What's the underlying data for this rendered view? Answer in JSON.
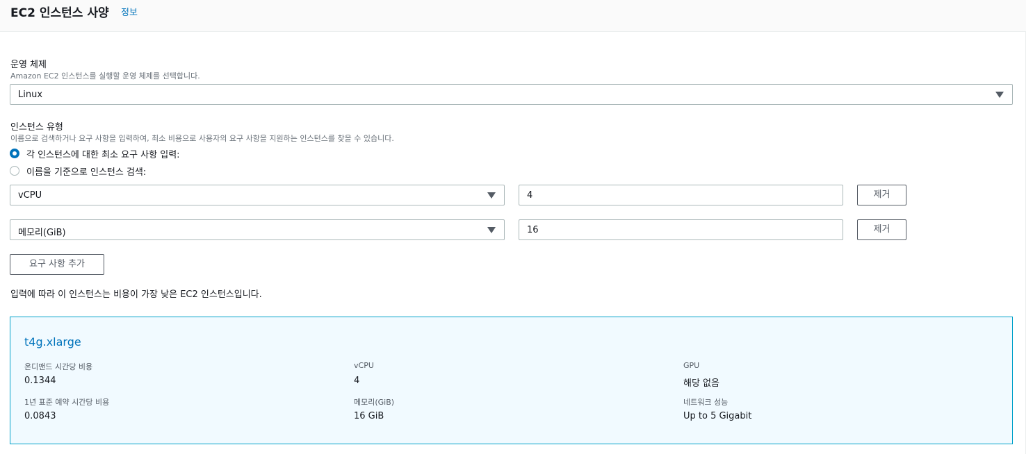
{
  "header": {
    "title": "EC2 인스턴스 사양",
    "info_link": "정보"
  },
  "os": {
    "label": "운영 체제",
    "description": "Amazon EC2 인스턴스를 실행할 운영 체제를 선택합니다.",
    "selected": "Linux"
  },
  "instance_type": {
    "label": "인스턴스 유형",
    "description": "이름으로 검색하거나 요구 사항을 입력하여, 최소 비용으로 사용자의 요구 사항을 지원하는 인스턴스를 찾을 수 있습니다.",
    "radio_requirements": "각 인스턴스에 대한 최소 요구 사항 입력:",
    "radio_search": "이름을 기준으로 인스턴스 검색:"
  },
  "requirements": [
    {
      "attribute": "vCPU",
      "value": "4",
      "remove_label": "제거"
    },
    {
      "attribute": "메모리(GiB)",
      "value": "16",
      "remove_label": "제거"
    }
  ],
  "add_requirement_label": "요구 사항 추가",
  "result_note": "입력에 따라 이 인스턴스는 비용이 가장 낮은 EC2 인스턴스입니다.",
  "result": {
    "name": "t4g.xlarge",
    "on_demand_label": "온디맨드 시간당 비용",
    "on_demand_value": "0.1344",
    "reserved_label": "1년 표준 예약 시간당 비용",
    "reserved_value": "0.0843",
    "vcpu_label": "vCPU",
    "vcpu_value": "4",
    "memory_label": "메모리(GiB)",
    "memory_value": "16 GiB",
    "gpu_label": "GPU",
    "gpu_value": "해당 없음",
    "network_label": "네트워크 성능",
    "network_value": "Up to 5 Gigabit"
  }
}
